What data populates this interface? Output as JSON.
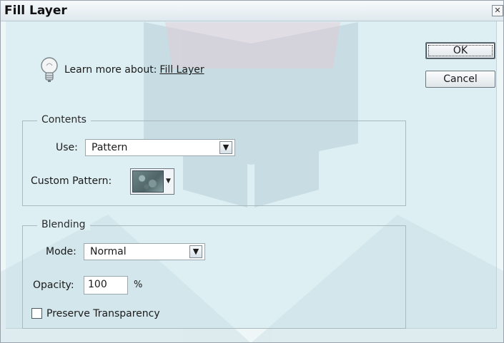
{
  "dialog": {
    "title": "Fill Layer",
    "close_icon": "close-icon"
  },
  "learn_more": {
    "prefix": "Learn more about:",
    "link": "Fill Layer",
    "icon": "lightbulb-icon"
  },
  "buttons": {
    "ok": "OK",
    "cancel": "Cancel"
  },
  "contents": {
    "legend": "Contents",
    "use_label": "Use:",
    "use_value": "Pattern",
    "custom_pattern_label": "Custom Pattern:"
  },
  "blending": {
    "legend": "Blending",
    "mode_label": "Mode:",
    "mode_value": "Normal",
    "opacity_label": "Opacity:",
    "opacity_value": "100",
    "opacity_unit": "%",
    "preserve_label": "Preserve Transparency",
    "preserve_checked": false
  }
}
